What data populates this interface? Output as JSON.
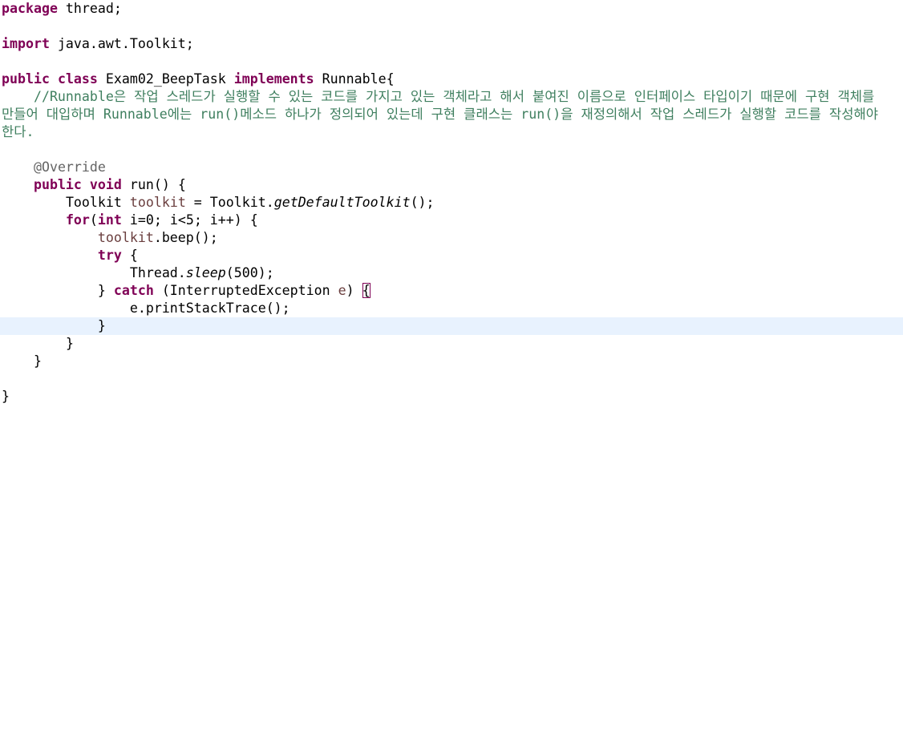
{
  "code": {
    "l1": {
      "kw": "package",
      "rest": " thread;"
    },
    "l3": {
      "kw": "import",
      "rest": " java.awt.Toolkit;"
    },
    "l5": {
      "kw1": "public",
      "kw2": "class",
      "name": " Exam02_BeepTask ",
      "kw3": "implements",
      "rest": " Runnable{"
    },
    "comment": {
      "line1": "    //Runnable은 작업 스레드가 실행할 수 있는 코드를 가지고 있는 객체라고 해서 붙여진 이름으로 인터페이스 타입이기 때문에 구현 객체를",
      "line2": "만들어 대입하며 Runnable에는 run()메소드 하나가 정의되어 있는데 구현 클래스는 run()을 재정의해서 작업 스레드가 실행할 코드를 작성해야",
      "line3": "한다."
    },
    "annotation": "@Override",
    "run_decl": {
      "kw1": "public",
      "kw2": "void",
      "rest": " run() {"
    },
    "toolkit_line": {
      "type": "Toolkit ",
      "var": "toolkit",
      "assign": " = Toolkit.",
      "method": "getDefaultToolkit",
      "end": "();"
    },
    "for_line": {
      "kw1": "for",
      "p1": "(",
      "kw2": "int",
      "rest": " i=0; i<5; i++) {"
    },
    "beep_line": {
      "var": "toolkit",
      "rest": ".beep();"
    },
    "try_line": {
      "kw": "try",
      "rest": " {"
    },
    "sleep_line": {
      "cls": "Thread.",
      "method": "sleep",
      "rest": "(500);"
    },
    "catch_line": {
      "pre": "} ",
      "kw": "catch",
      "mid": " (InterruptedException ",
      "var": "e",
      "sp": ") ",
      "brace": "{"
    },
    "print_line": "e.printStackTrace();",
    "close_catch": "}",
    "close_for": "}",
    "close_run": "}",
    "close_class": "}"
  },
  "colors": {
    "keyword": "#7f0055",
    "comment": "#3f7f5f",
    "annotation": "#646464",
    "local_var": "#6a3e3e",
    "current_line": "#e8f2fe"
  }
}
